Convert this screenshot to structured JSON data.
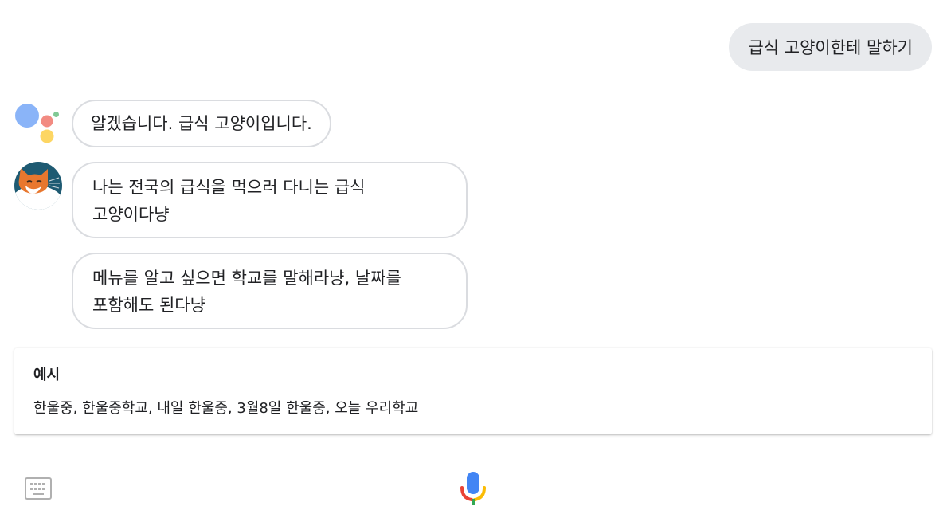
{
  "conversation": {
    "user_message": "급식 고양이한테 말하기",
    "assistant_message": "알겠습니다. 급식 고양이입니다.",
    "bot_messages": [
      {
        "line1": "나는 전국의 급식을 먹으러 다니는 급식",
        "line2": "고양이다냥"
      },
      {
        "line1": "메뉴를 알고 싶으면 학교를 말해라냥, 날짜를",
        "line2": "포함해도 된다냥"
      }
    ]
  },
  "example_card": {
    "title": "예시",
    "text": "한울중, 한울중학교, 내일 한울중, 3월8일 한울중, 오늘 우리학교"
  },
  "icons": {
    "assistant": "google-assistant-logo",
    "avatar": "cat-avatar",
    "keyboard": "keyboard-icon",
    "mic": "microphone-icon"
  },
  "colors": {
    "user_bubble_bg": "#e8eaed",
    "bubble_border": "#dadce0",
    "google_blue": "#4285f4",
    "google_red": "#ea4335",
    "google_yellow": "#fbbc05",
    "google_green": "#34a853",
    "avatar_bg": "#1e5a72",
    "cat_orange": "#e8772e"
  }
}
